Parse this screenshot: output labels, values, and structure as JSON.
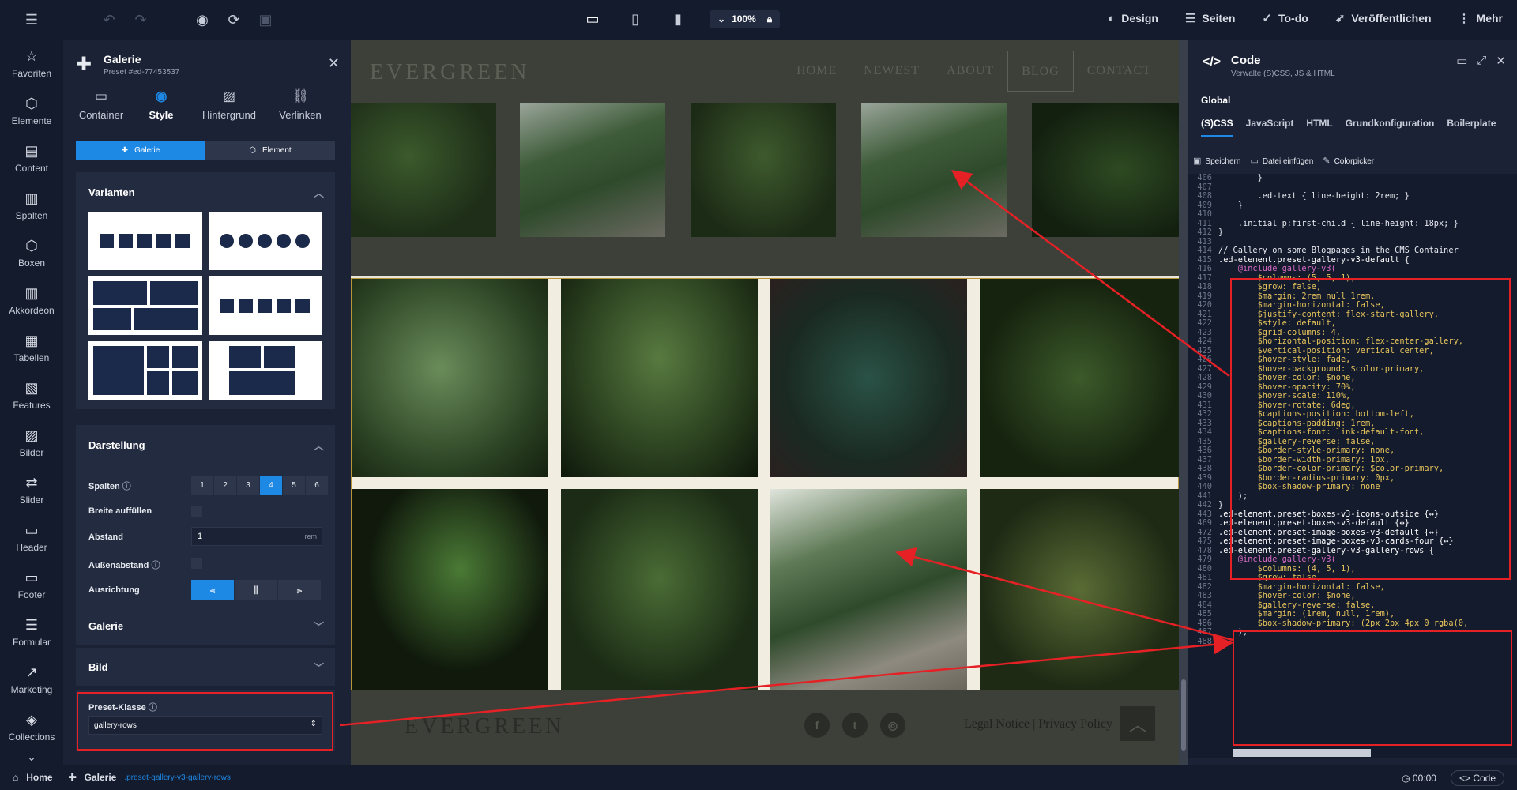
{
  "toolbar": {
    "zoom": "100%",
    "right_items": [
      "Design",
      "Seiten",
      "To-do",
      "Veröffentlichen",
      "Mehr"
    ]
  },
  "rail": [
    "Favoriten",
    "Elemente",
    "Content",
    "Spalten",
    "Boxen",
    "Akkordeon",
    "Tabellen",
    "Features",
    "Bilder",
    "Slider",
    "Header",
    "Footer",
    "Formular",
    "Marketing",
    "Collections"
  ],
  "props": {
    "title": "Galerie",
    "subtitle": "Preset #ed-77453537",
    "tabs": [
      "Container",
      "Style",
      "Hintergrund",
      "Verlinken"
    ],
    "segment": [
      "Galerie",
      "Element"
    ],
    "varianten": "Varianten",
    "darstellung": "Darstellung",
    "spalten_label": "Spalten",
    "spalten_values": [
      "1",
      "2",
      "3",
      "4",
      "5",
      "6"
    ],
    "breite_label": "Breite auffüllen",
    "abstand_label": "Abstand",
    "abstand_value": "1",
    "abstand_unit": "rem",
    "aussen_label": "Außenabstand",
    "ausrichtung_label": "Ausrichtung",
    "galerie_section": "Galerie",
    "bild_section": "Bild",
    "preset_label": "Preset-Klasse",
    "preset_value": "gallery-rows"
  },
  "site": {
    "brand": "EVERGREEN",
    "menu": [
      "HOME",
      "NEWEST",
      "ABOUT",
      "BLOG",
      "CONTACT"
    ],
    "footer_brand": "EVERGREEN",
    "legal": "Legal Notice | Privacy Policy"
  },
  "code": {
    "title": "Code",
    "subtitle": "Verwalte (S)CSS, JS & HTML",
    "global": "Global",
    "tabs": [
      "(S)CSS",
      "JavaScript",
      "HTML",
      "Grundkonfiguration",
      "Boilerplate"
    ],
    "tools": [
      "Speichern",
      "Datei einfügen",
      "Colorpicker"
    ],
    "lines": [
      {
        "n": "406",
        "t": "        }"
      },
      {
        "n": "407",
        "t": ""
      },
      {
        "n": "408",
        "t": "        .ed-text { line-height: 2rem; }"
      },
      {
        "n": "409",
        "t": "    }"
      },
      {
        "n": "410",
        "t": ""
      },
      {
        "n": "411",
        "t": "    .initial p:first-child { line-height: 18px; }"
      },
      {
        "n": "412",
        "t": "}"
      },
      {
        "n": "413",
        "t": ""
      },
      {
        "n": "414",
        "t": "// Gallery on some Blogpages in the CMS Container"
      },
      {
        "n": "415",
        "t": ".ed-element.preset-gallery-v3-default {"
      },
      {
        "n": "416",
        "t": "    @include gallery-v3("
      },
      {
        "n": "417",
        "t": "        $columns: (5, 5, 1),"
      },
      {
        "n": "418",
        "t": "        $grow: false,"
      },
      {
        "n": "419",
        "t": "        $margin: 2rem null 1rem,"
      },
      {
        "n": "420",
        "t": "        $margin-horizontal: false,"
      },
      {
        "n": "421",
        "t": "        $justify-content: flex-start-gallery,"
      },
      {
        "n": "422",
        "t": "        $style: default,"
      },
      {
        "n": "423",
        "t": "        $grid-columns: 4,"
      },
      {
        "n": "424",
        "t": "        $horizontal-position: flex-center-gallery,"
      },
      {
        "n": "425",
        "t": "        $vertical-position: vertical_center,"
      },
      {
        "n": "426",
        "t": "        $hover-style: fade,"
      },
      {
        "n": "427",
        "t": "        $hover-background: $color-primary,"
      },
      {
        "n": "428",
        "t": "        $hover-color: $none,"
      },
      {
        "n": "429",
        "t": "        $hover-opacity: 70%,"
      },
      {
        "n": "430",
        "t": "        $hover-scale: 110%,"
      },
      {
        "n": "431",
        "t": "        $hover-rotate: 6deg,"
      },
      {
        "n": "432",
        "t": "        $captions-position: bottom-left,"
      },
      {
        "n": "433",
        "t": "        $captions-padding: 1rem,"
      },
      {
        "n": "434",
        "t": "        $captions-font: link-default-font,"
      },
      {
        "n": "435",
        "t": "        $gallery-reverse: false,"
      },
      {
        "n": "436",
        "t": "        $border-style-primary: none,"
      },
      {
        "n": "437",
        "t": "        $border-width-primary: 1px,"
      },
      {
        "n": "438",
        "t": "        $border-color-primary: $color-primary,"
      },
      {
        "n": "439",
        "t": "        $border-radius-primary: 0px,"
      },
      {
        "n": "440",
        "t": "        $box-shadow-primary: none"
      },
      {
        "n": "441",
        "t": "    );"
      },
      {
        "n": "442",
        "t": "}"
      },
      {
        "n": "443",
        "t": ".ed-element.preset-boxes-v3-icons-outside {↔}"
      },
      {
        "n": "469",
        "t": ".ed-element.preset-boxes-v3-default {↔}"
      },
      {
        "n": "472",
        "t": ".ed-element.preset-image-boxes-v3-default {↔}"
      },
      {
        "n": "475",
        "t": ".ed-element.preset-image-boxes-v3-cards-four {↔}"
      },
      {
        "n": "478",
        "t": ".ed-element.preset-gallery-v3-gallery-rows {"
      },
      {
        "n": "479",
        "t": "    @include gallery-v3("
      },
      {
        "n": "480",
        "t": "        $columns: (4, 5, 1),"
      },
      {
        "n": "481",
        "t": "        $grow: false,"
      },
      {
        "n": "482",
        "t": "        $margin-horizontal: false,"
      },
      {
        "n": "483",
        "t": "        $hover-color: $none,"
      },
      {
        "n": "484",
        "t": "        $gallery-reverse: false,"
      },
      {
        "n": "485",
        "t": "        $margin: (1rem, null, 1rem),"
      },
      {
        "n": "486",
        "t": "        $box-shadow-primary: (2px 2px 4px 0 rgba(0,"
      },
      {
        "n": "487",
        "t": "    );"
      },
      {
        "n": "488",
        "t": "}"
      }
    ]
  },
  "status": {
    "home": "Home",
    "element": "Galerie",
    "class": ".preset-gallery-v3-gallery-rows",
    "time": "00:00",
    "code_btn": "Code"
  },
  "colors": {
    "accent": "#1e88e5",
    "highlight": "#e52126",
    "panel": "#1b2235",
    "dark": "#141b2d"
  }
}
